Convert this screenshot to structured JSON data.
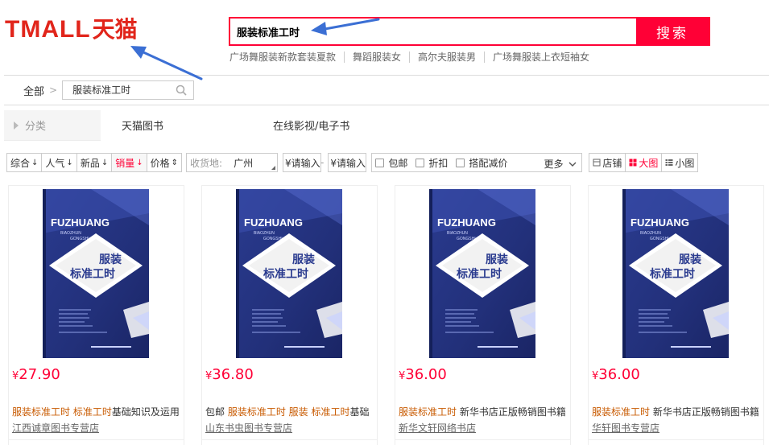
{
  "header": {
    "logo_text": "TMALL",
    "logo_cn": "天猫",
    "search_value": "服装标准工时",
    "search_button": "搜索",
    "hot_words": [
      "广场舞服装新款套装夏款",
      "舞蹈服装女",
      "高尔夫服装男",
      "广场舞服装上衣短袖女"
    ]
  },
  "breadcrumb": {
    "all": "全部",
    "sep": ">",
    "input_value": "服装标准工时"
  },
  "category": {
    "label": "分类",
    "items": [
      "天猫图书",
      "在线影视/电子书"
    ]
  },
  "sort": {
    "buttons": [
      {
        "label": "综合",
        "arrow": "↓"
      },
      {
        "label": "人气",
        "arrow": "↓"
      },
      {
        "label": "新品",
        "arrow": "↓"
      },
      {
        "label": "销量",
        "arrow": "↓"
      },
      {
        "label": "价格",
        "arrow": "⇕"
      }
    ],
    "ship_from_label": "收货地:",
    "ship_from_city": "广州",
    "price_min": "¥请输入",
    "price_dash": "-",
    "price_max": "¥请输入",
    "checks": [
      "包邮",
      "折扣",
      "搭配减价"
    ],
    "more": "更多",
    "views": [
      "店铺",
      "大图",
      "小图"
    ]
  },
  "products": [
    {
      "price": "27.90",
      "title_parts": [
        {
          "t": "服装标准工时",
          "hl": true
        },
        {
          "t": " ",
          "hl": false
        },
        {
          "t": "标准工时",
          "hl": true
        },
        {
          "t": "基础知识及运用",
          "hl": false
        }
      ],
      "shop": "江西诚章图书专营店",
      "cover": {
        "en": "FUZHUANG",
        "pinyin1": "BIAOZHUN",
        "pinyin2": "GONGSHI",
        "cn1": "服装",
        "cn2": "标准工时"
      }
    },
    {
      "price": "36.80",
      "title_parts": [
        {
          "t": "包邮 ",
          "hl": false
        },
        {
          "t": "服装标准工时",
          "hl": true
        },
        {
          "t": " ",
          "hl": false
        },
        {
          "t": "服装",
          "hl": true
        },
        {
          "t": " ",
          "hl": false
        },
        {
          "t": "标准工时",
          "hl": true
        },
        {
          "t": "基础",
          "hl": false
        }
      ],
      "shop": "山东书虫图书专营店",
      "cover": {
        "en": "FUZHUANG",
        "pinyin1": "BIAOZHUN",
        "pinyin2": "GONGSHI",
        "cn1": "服装",
        "cn2": "标准工时"
      }
    },
    {
      "price": "36.00",
      "title_parts": [
        {
          "t": "服装标准工时",
          "hl": true
        },
        {
          "t": " 新华书店正版畅销图书籍",
          "hl": false
        }
      ],
      "shop": "新华文轩网络书店",
      "cover": {
        "en": "FUZHUANG",
        "pinyin1": "BIAOZHUN",
        "pinyin2": "GONGSHI",
        "cn1": "服装",
        "cn2": "标准工时"
      }
    },
    {
      "price": "36.00",
      "title_parts": [
        {
          "t": "服装标准工时",
          "hl": true
        },
        {
          "t": " 新华书店正版畅销图书籍",
          "hl": false
        }
      ],
      "shop": "华轩图书专营店",
      "cover": {
        "en": "FUZHUANG",
        "pinyin1": "BIAOZHUN",
        "pinyin2": "GONGSHI",
        "cn1": "服装",
        "cn2": "标准工时"
      }
    }
  ],
  "currency": "¥",
  "colors": {
    "brand": "#ff0036",
    "highlight": "#c85a00",
    "annotation": "#3b6fd4"
  }
}
